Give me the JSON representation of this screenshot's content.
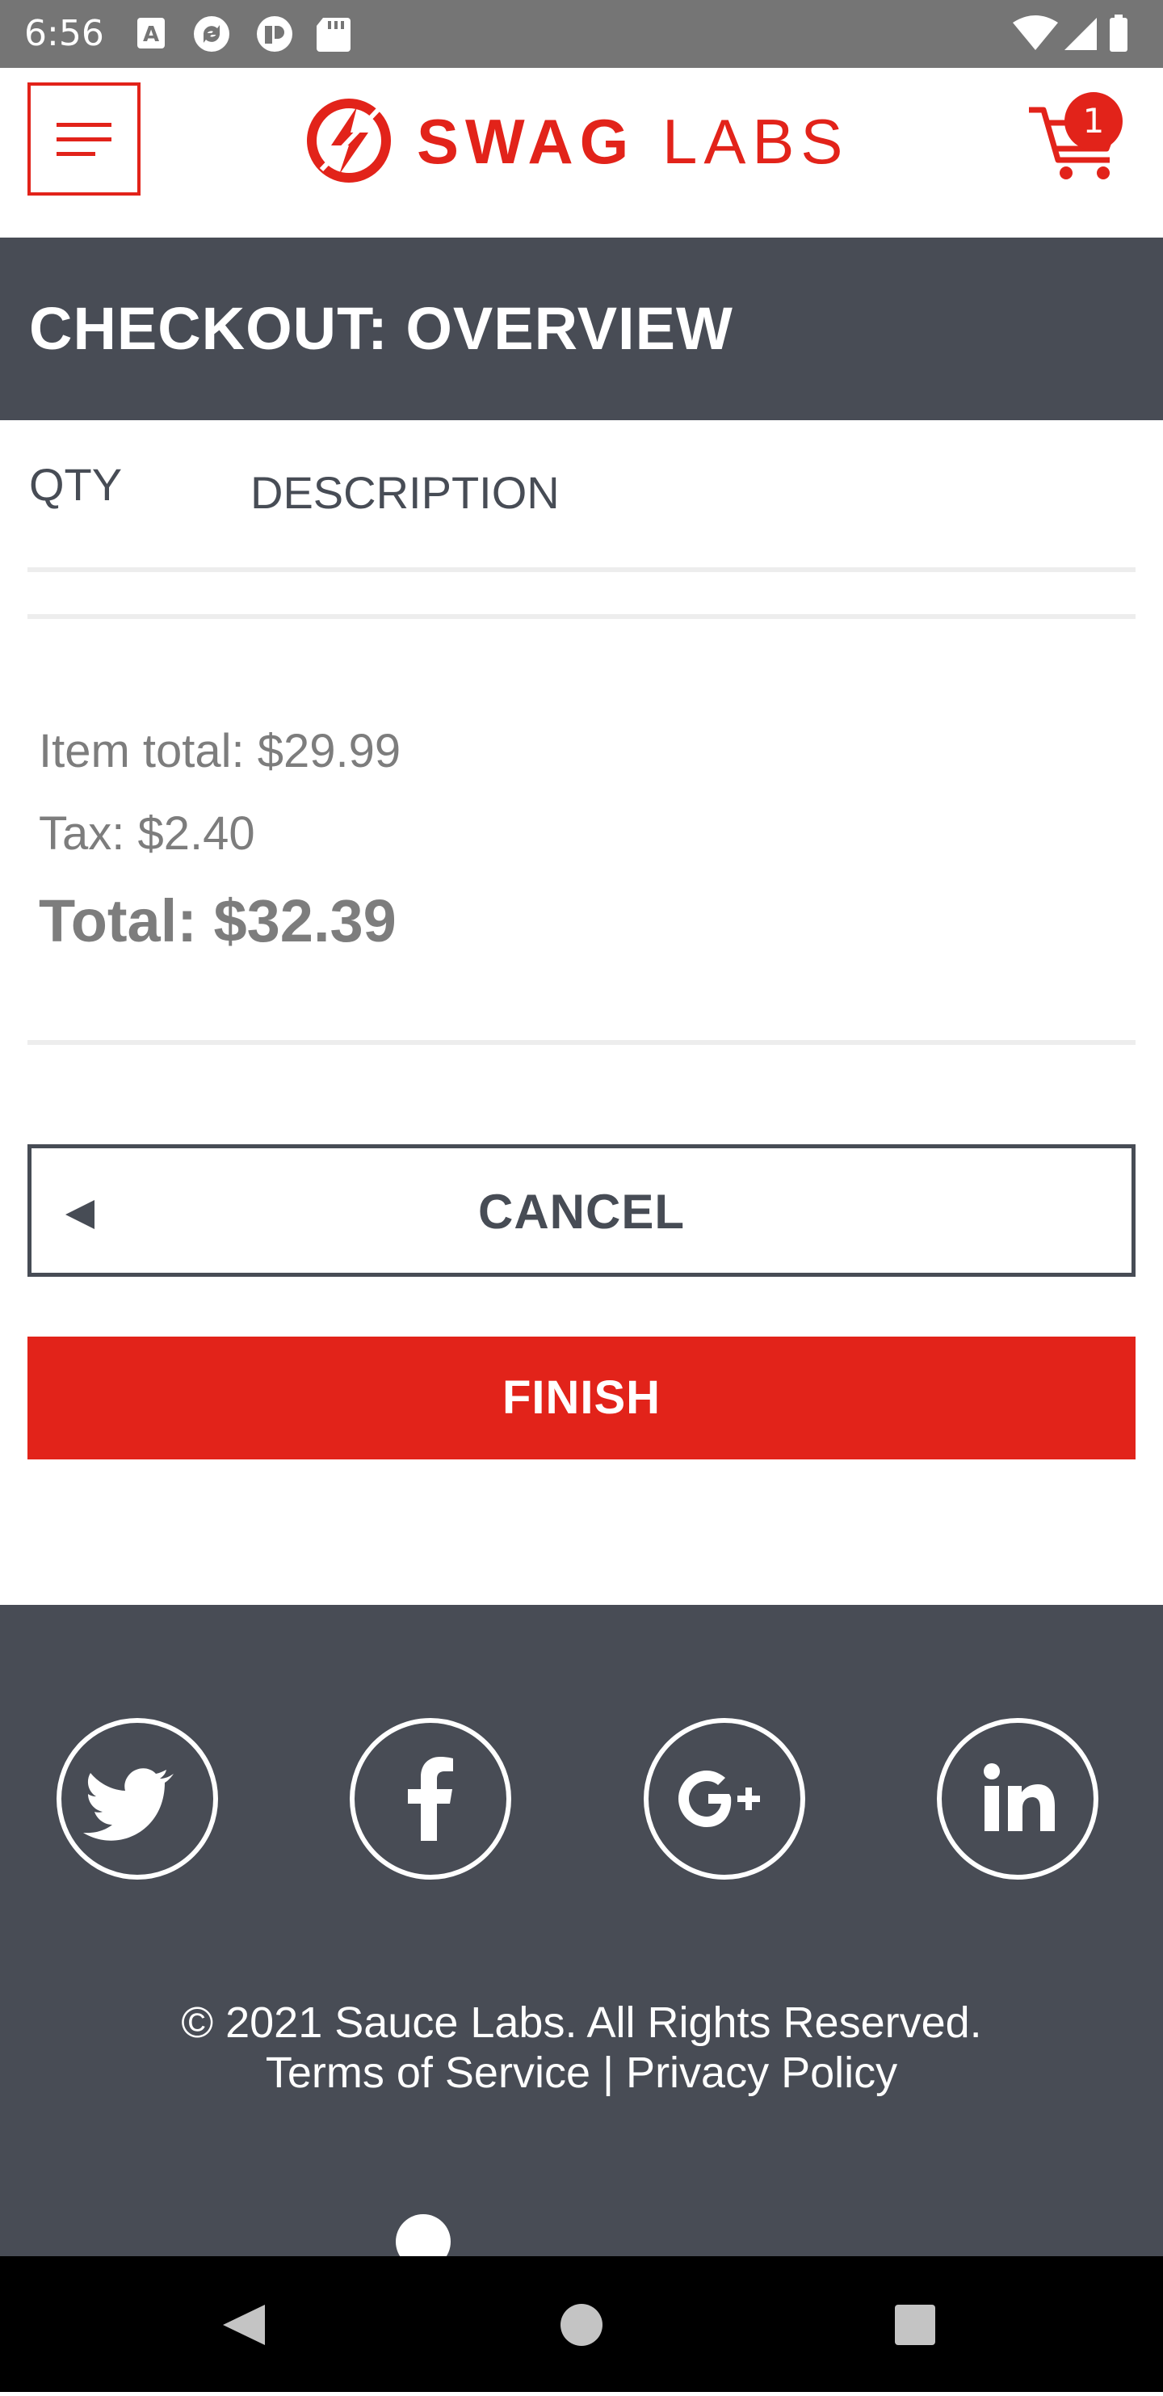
{
  "status_bar": {
    "time": "6:56",
    "left_icons": [
      "a-notification-icon",
      "sync-icon",
      "pocket-icon",
      "sd-card-icon"
    ],
    "right_icons": [
      "wifi-icon",
      "signal-icon",
      "battery-icon"
    ]
  },
  "header": {
    "menu_icon": "hamburger-menu-icon",
    "brand_primary": "SWAG",
    "brand_secondary": "LABS",
    "cart_icon": "cart-icon",
    "cart_count": "1",
    "accent_color": "#e2231a"
  },
  "subheader": {
    "title": "CHECKOUT: OVERVIEW",
    "background_color": "#484c55"
  },
  "cart_list": {
    "qty_label": "QTY",
    "description_label": "DESCRIPTION"
  },
  "summary": {
    "item_total": "Item total: $29.99",
    "tax": "Tax: $2.40",
    "total": "Total: $32.39"
  },
  "buttons": {
    "cancel_label": "CANCEL",
    "finish_label": "FINISH"
  },
  "footer": {
    "social": [
      "twitter-icon",
      "facebook-icon",
      "google-plus-icon",
      "linkedin-icon"
    ],
    "copyright": "© 2021 Sauce Labs. All Rights Reserved.",
    "terms": "Terms of Service",
    "separator": "|",
    "privacy": "Privacy Policy"
  },
  "nav_bar": {
    "icons": [
      "back-icon",
      "home-icon",
      "recents-icon"
    ]
  }
}
